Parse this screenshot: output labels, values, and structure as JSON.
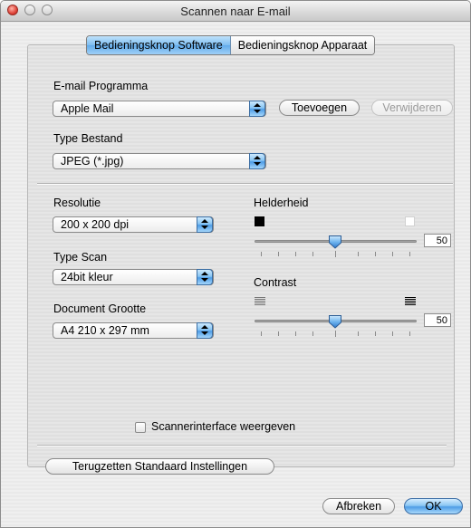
{
  "window": {
    "title": "Scannen naar E-mail"
  },
  "tabs": [
    {
      "label": "Bedieningsknop Software",
      "active": true
    },
    {
      "label": "Bedieningsknop Apparaat",
      "active": false
    }
  ],
  "email": {
    "label": "E-mail Programma",
    "selected": "Apple Mail",
    "add_button": "Toevoegen",
    "remove_button": "Verwijderen"
  },
  "file_type": {
    "label": "Type Bestand",
    "selected": "JPEG (*.jpg)"
  },
  "resolution": {
    "label": "Resolutie",
    "selected": "200 x 200 dpi"
  },
  "scan_type": {
    "label": "Type Scan",
    "selected": "24bit kleur"
  },
  "doc_size": {
    "label": "Document Grootte",
    "selected": "A4  210 x 297 mm"
  },
  "brightness": {
    "label": "Helderheid",
    "value": "50"
  },
  "contrast": {
    "label": "Contrast",
    "value": "50"
  },
  "scanner_interface": {
    "label": "Scannerinterface weergeven",
    "checked": false
  },
  "reset_button": "Terugzetten Standaard Instellingen",
  "cancel_button": "Afbreken",
  "ok_button": "OK"
}
